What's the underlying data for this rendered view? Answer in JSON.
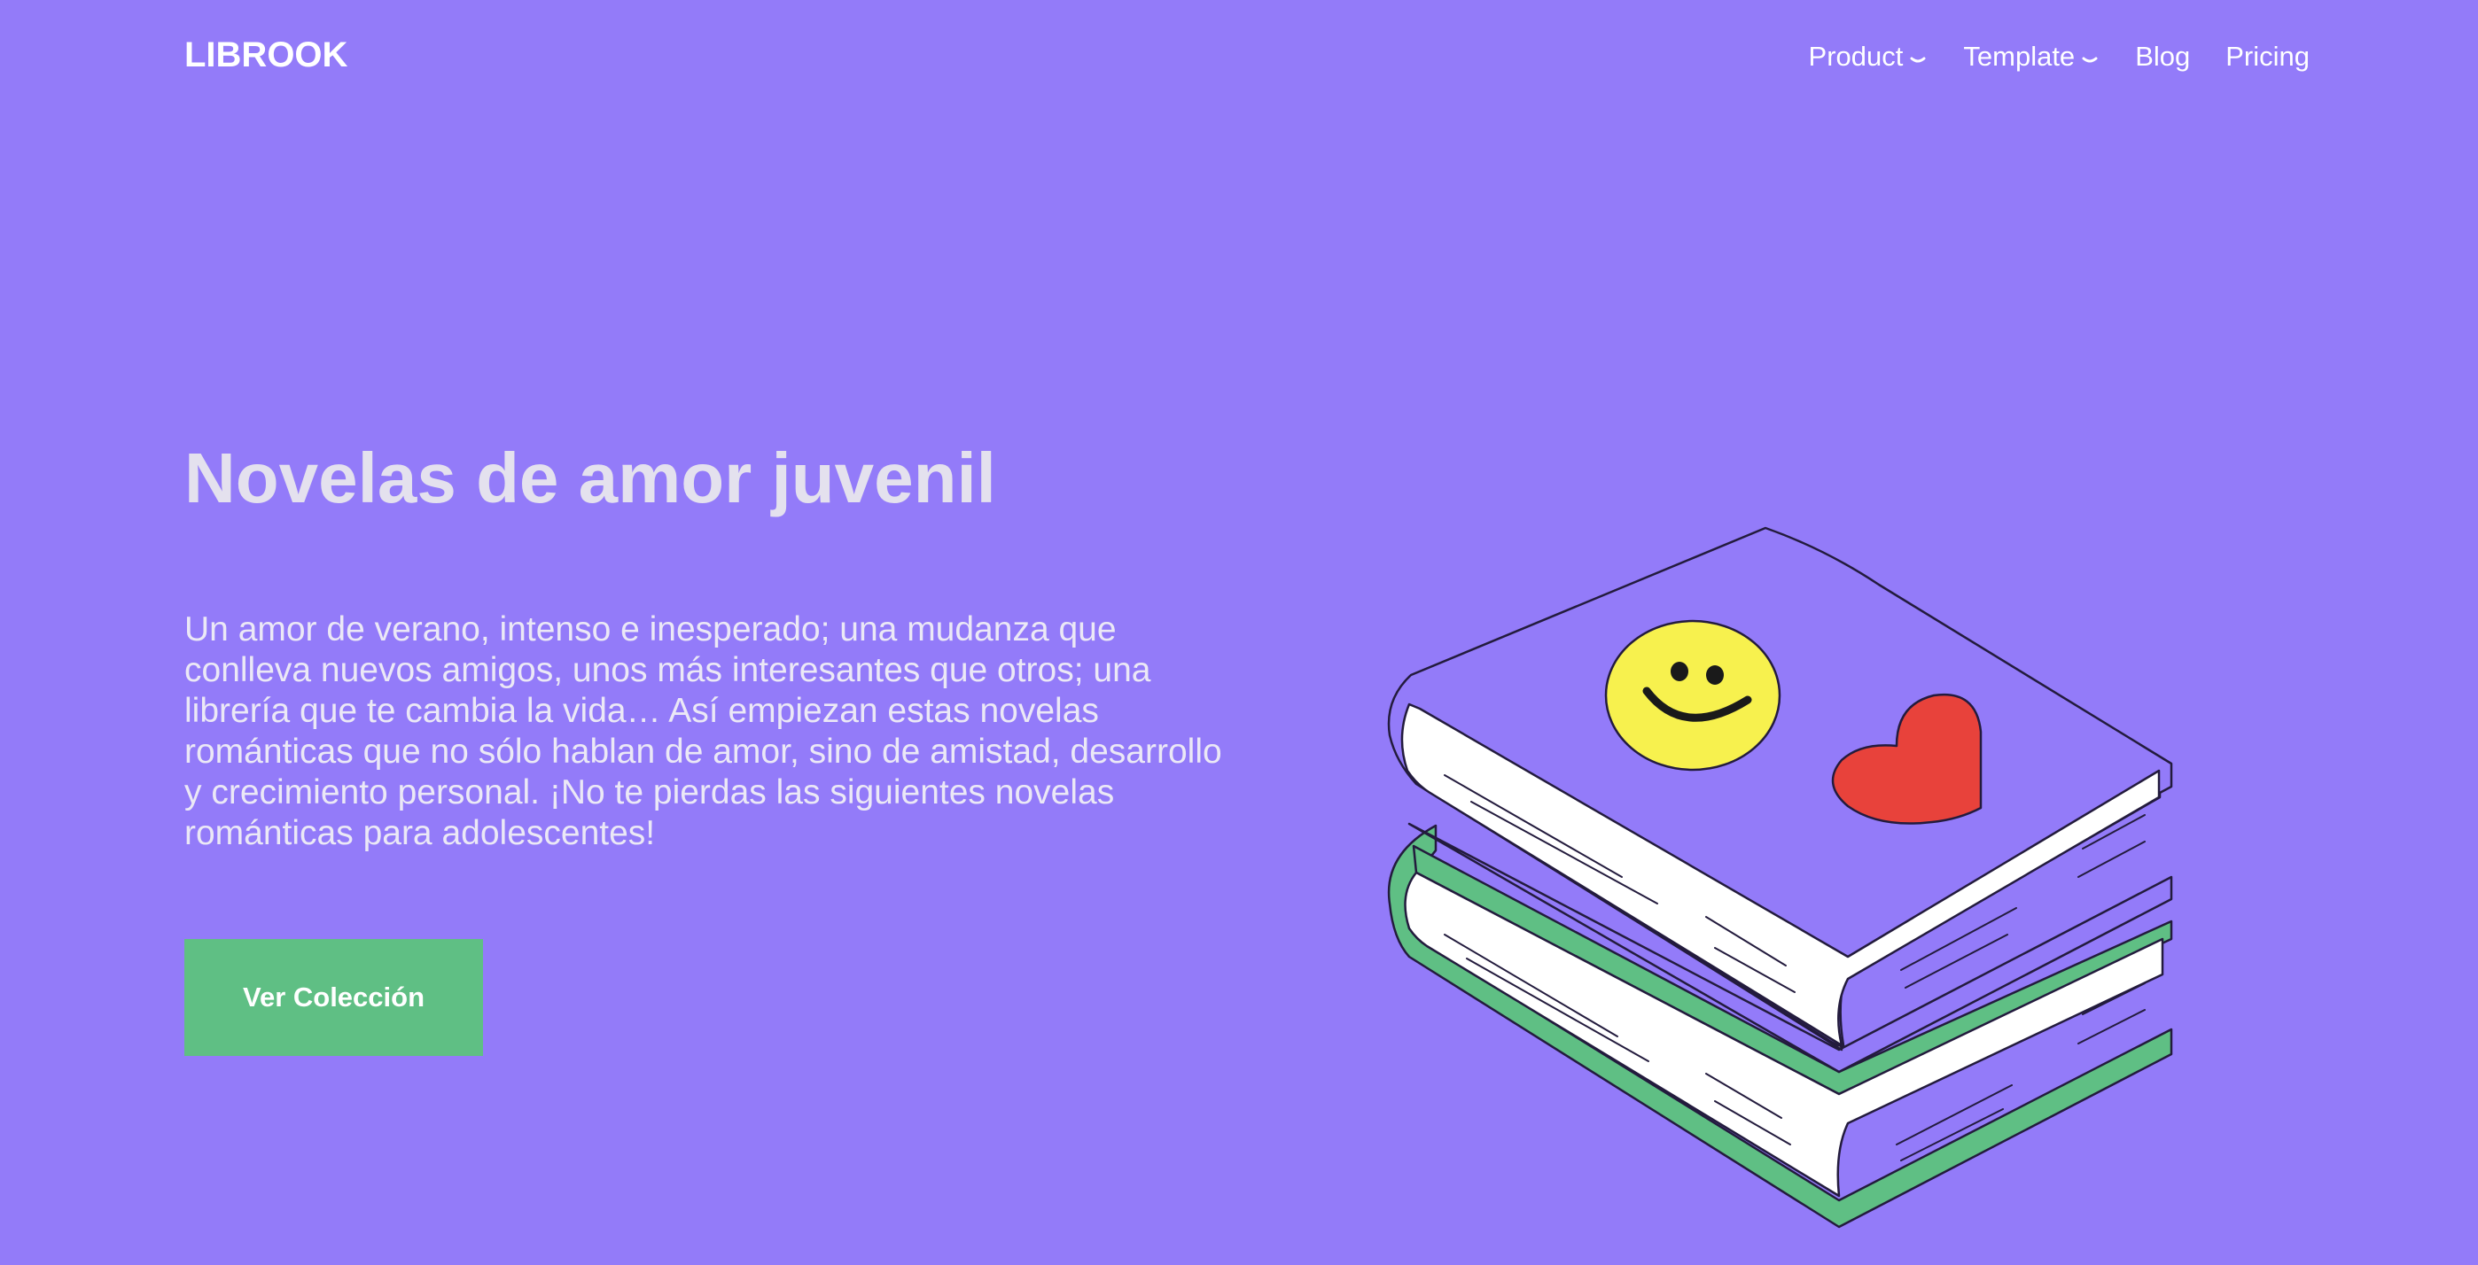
{
  "brand": {
    "logo_text": "LIBROOK"
  },
  "nav": {
    "items": [
      {
        "label": "Product",
        "has_dropdown": true
      },
      {
        "label": "Template",
        "has_dropdown": true
      },
      {
        "label": "Blog",
        "has_dropdown": false
      },
      {
        "label": "Pricing",
        "has_dropdown": false
      }
    ]
  },
  "hero": {
    "title": "Novelas de amor juvenil",
    "description": "Un amor de verano, intenso e inesperado; una mudanza que conlleva nuevos amigos, unos más interesantes que otros; una librería que te cambia la vida… Así empiezan estas novelas románticas que no sólo hablan de amor, sino de amistad, desarrollo y crecimiento personal. ¡No te pierdas las siguientes novelas románticas para adolescentes!",
    "cta_label": "Ver Colección"
  },
  "illustration": {
    "subject": "stack-of-books",
    "stickers": [
      "smiley-face-icon",
      "heart-icon"
    ]
  },
  "colors": {
    "background": "#937bf9",
    "cta": "#5fbf84",
    "book_top": "#937bf9",
    "book_bottom": "#5fbf84",
    "smiley": "#f7f14e",
    "heart": "#e8423b"
  },
  "icons": {
    "dropdown": "chevron-down-icon"
  }
}
